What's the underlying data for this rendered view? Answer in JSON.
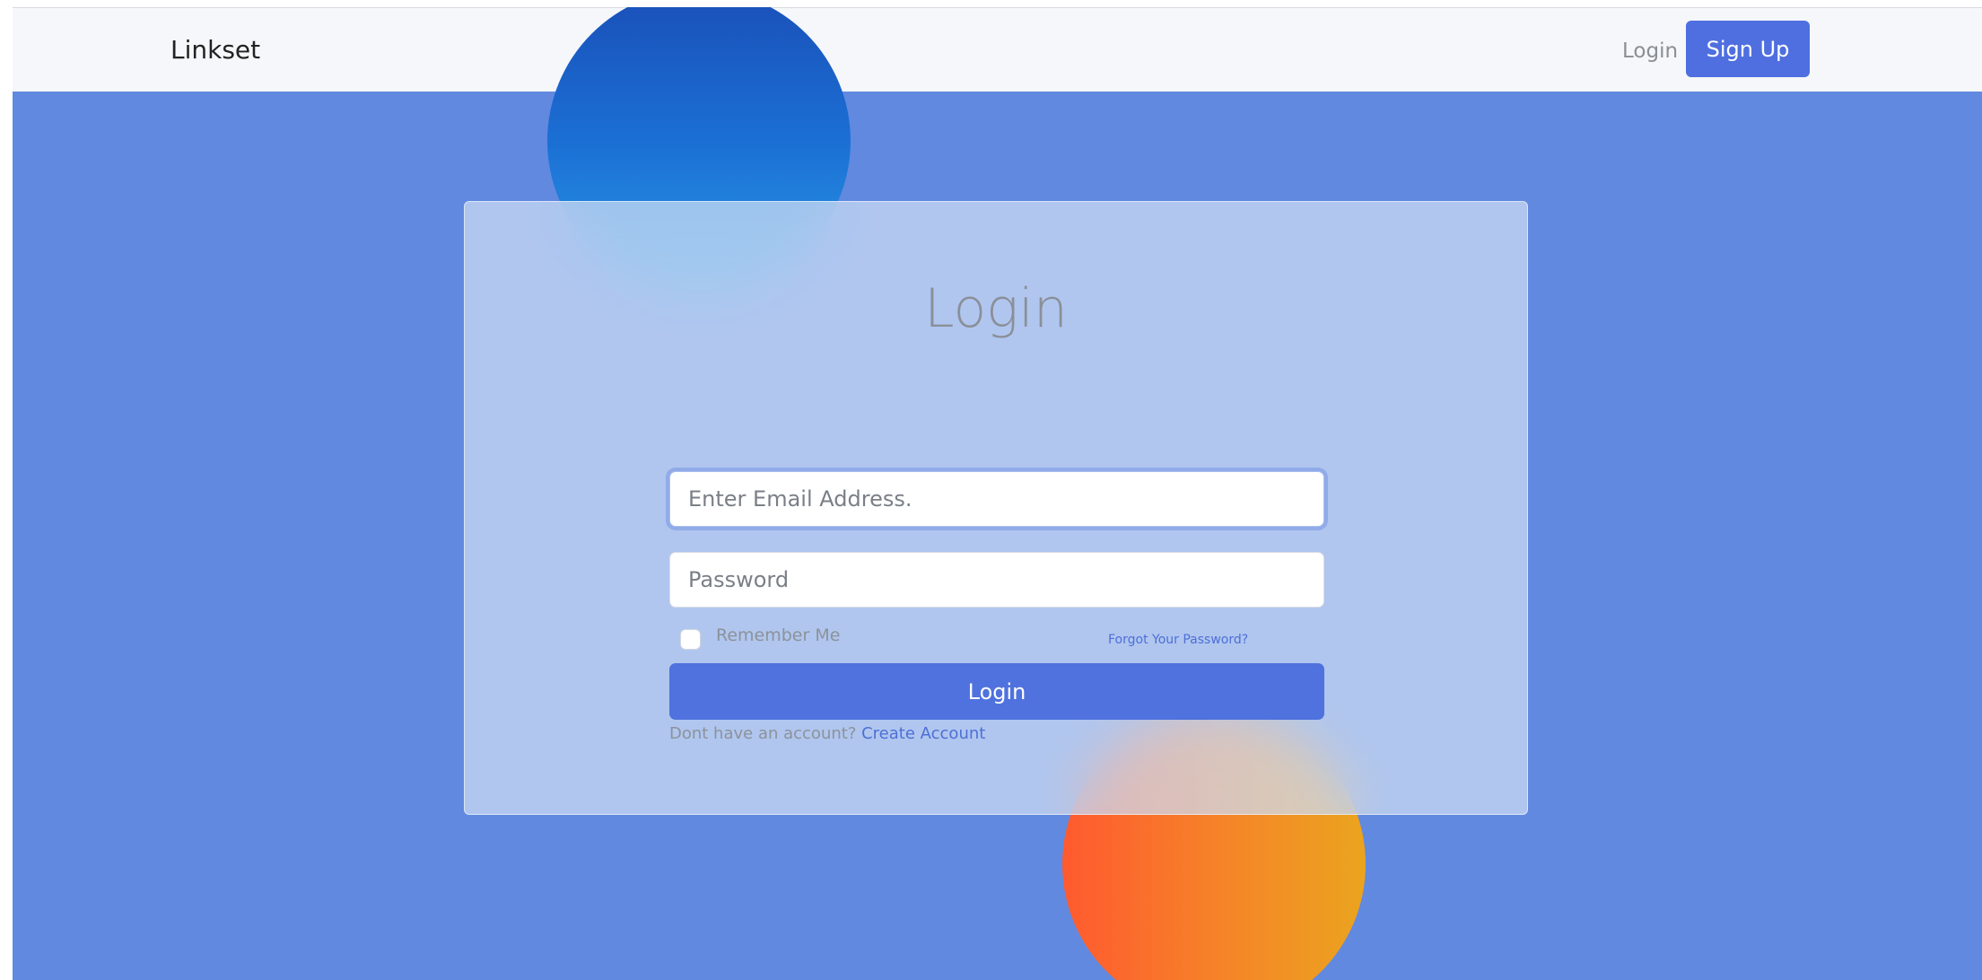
{
  "navbar": {
    "brand": "Linkset",
    "login_link": "Login",
    "signup_button": "Sign Up"
  },
  "form": {
    "title": "Login",
    "email_placeholder": "Enter Email Address.",
    "password_placeholder": "Password",
    "remember_label": "Remember Me",
    "remember_checked": false,
    "forgot_link": "Forgot Your Password?",
    "submit_label": "Login",
    "no_account_text": "Dont have an account?",
    "create_account_link": "Create Account"
  },
  "colors": {
    "background": "#6189e0",
    "accent": "#4f72de",
    "blob_blue": "#1b6fd4",
    "blob_orange": "#f58528"
  }
}
